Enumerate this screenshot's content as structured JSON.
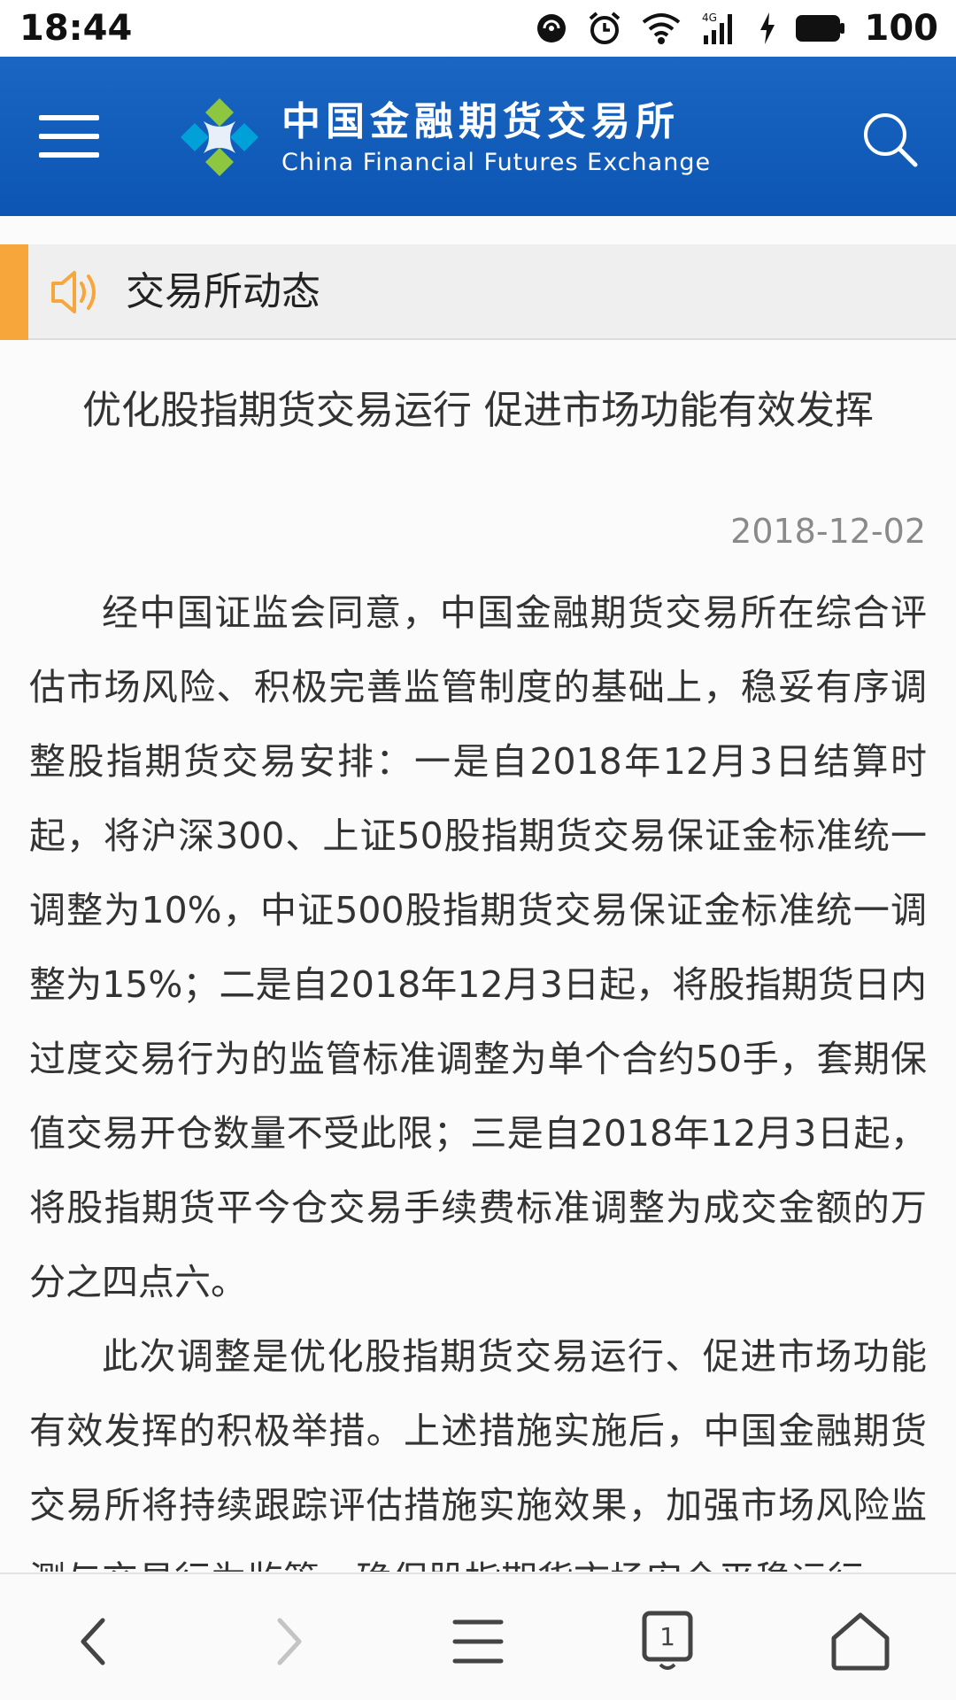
{
  "status_bar": {
    "time": "18:44",
    "battery_percent": "100",
    "icons": [
      "nfc-icon",
      "alarm-icon",
      "wifi-icon",
      "signal-4g-icon",
      "charging-icon",
      "battery-icon"
    ]
  },
  "header": {
    "logo_cn": "中国金融期货交易所",
    "logo_en": "China Financial Futures Exchange",
    "brand_color": "#0d55b3",
    "menu_icon": "hamburger-menu-icon",
    "search_icon": "search-icon"
  },
  "section": {
    "title": "交易所动态",
    "icon": "speaker-icon",
    "accent_color": "#f6a63a"
  },
  "article": {
    "title": "优化股指期货交易运行 促进市场功能有效发挥",
    "date": "2018-12-02",
    "paragraphs": [
      "经中国证监会同意，中国金融期货交易所在综合评估市场风险、积极完善监管制度的基础上，稳妥有序调整股指期货交易安排：一是自2018年12月3日结算时起，将沪深300、上证50股指期货交易保证金标准统一调整为10%，中证500股指期货交易保证金标准统一调整为15%；二是自2018年12月3日起，将股指期货日内过度交易行为的监管标准调整为单个合约50手，套期保值交易开仓数量不受此限；三是自2018年12月3日起，将股指期货平今仓交易手续费标准调整为成交金额的万分之四点六。",
      "此次调整是优化股指期货交易运行、促进市场功能有效发挥的积极举措。上述措施实施后，中国金融期货交易所将持续跟踪评估措施实施效果，加强市场风险监测与交易行为监管，确保股指期货市场安全平稳运行。"
    ]
  },
  "bottom_nav": {
    "tab_count": "1",
    "icons": [
      "back-icon",
      "forward-icon",
      "menu-icon",
      "tabs-icon",
      "home-icon"
    ]
  }
}
